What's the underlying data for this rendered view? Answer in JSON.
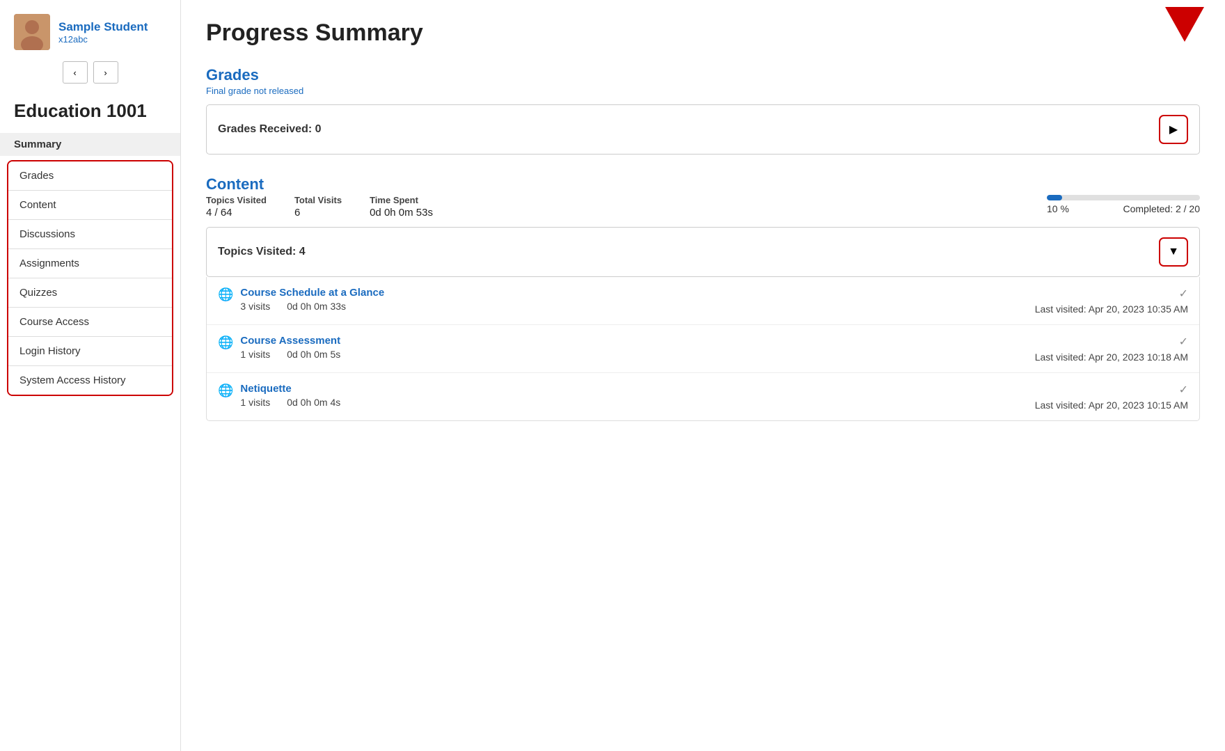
{
  "sidebar": {
    "user": {
      "name": "Sample Student",
      "id": "x12abc"
    },
    "course_title": "Education 1001",
    "nav_section_header": "Summary",
    "nav_items": [
      {
        "label": "Grades",
        "id": "grades"
      },
      {
        "label": "Content",
        "id": "content"
      },
      {
        "label": "Discussions",
        "id": "discussions"
      },
      {
        "label": "Assignments",
        "id": "assignments"
      },
      {
        "label": "Quizzes",
        "id": "quizzes"
      },
      {
        "label": "Course Access",
        "id": "course-access"
      },
      {
        "label": "Login History",
        "id": "login-history"
      },
      {
        "label": "System Access History",
        "id": "system-access-history"
      }
    ]
  },
  "main": {
    "page_title": "Progress Summary",
    "grades_section": {
      "title": "Grades",
      "subtitle": "Final grade not released",
      "grades_received_label": "Grades Received: 0"
    },
    "content_section": {
      "title": "Content",
      "topics_visited_label": "Topics Visited",
      "topics_visited_value": "4 / 64",
      "total_visits_label": "Total Visits",
      "total_visits_value": "6",
      "time_spent_label": "Time Spent",
      "time_spent_value": "0d 0h 0m 53s",
      "progress_pct": "10 %",
      "progress_completed": "Completed: 2 / 20",
      "progress_fill_pct": 10,
      "topics_visited_bar_text": "Topics Visited: 4",
      "topics": [
        {
          "name": "Course Schedule at a Glance",
          "visits": "3 visits",
          "time": "0d 0h 0m 33s",
          "last_visited": "Last visited: Apr 20, 2023 10:35 AM"
        },
        {
          "name": "Course Assessment",
          "visits": "1 visits",
          "time": "0d 0h 0m 5s",
          "last_visited": "Last visited: Apr 20, 2023 10:18 AM"
        },
        {
          "name": "Netiquette",
          "visits": "1 visits",
          "time": "0d 0h 0m 4s",
          "last_visited": "Last visited: Apr 20, 2023 10:15 AM"
        }
      ]
    }
  },
  "icons": {
    "prev_arrow": "‹",
    "next_arrow": "›",
    "right_arrow": "▶",
    "down_arrow": "▼",
    "check": "✓",
    "globe": "🌐"
  }
}
